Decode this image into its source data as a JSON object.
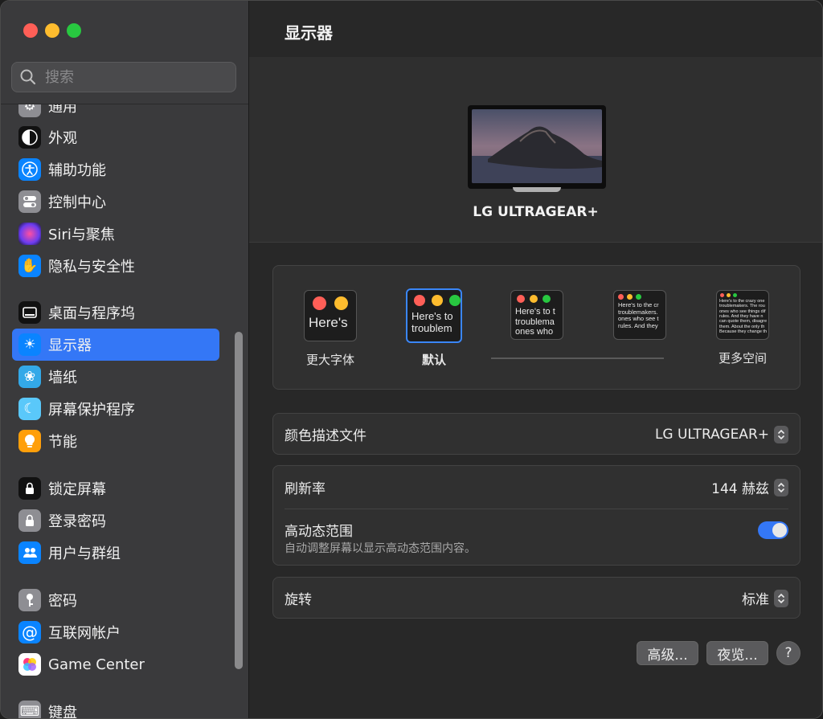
{
  "sidebar": {
    "search_placeholder": "搜索",
    "items": [
      {
        "label": "通用",
        "icon": "gear-icon",
        "color": "#8e8e93"
      },
      {
        "label": "外观",
        "icon": "appearance-icon",
        "color": "#1c1c1e"
      },
      {
        "label": "辅助功能",
        "icon": "accessibility-icon",
        "color": "#0a84ff"
      },
      {
        "label": "控制中心",
        "icon": "control-center-icon",
        "color": "#8e8e93"
      },
      {
        "label": "Siri与聚焦",
        "icon": "siri-icon",
        "color": "#b14ee0"
      },
      {
        "label": "隐私与安全性",
        "icon": "hand-icon",
        "color": "#0a84ff"
      },
      {
        "label": "桌面与程序坞",
        "icon": "dock-icon",
        "color": "#1c1c1e"
      },
      {
        "label": "显示器",
        "icon": "sun-icon",
        "color": "#0a84ff"
      },
      {
        "label": "墙纸",
        "icon": "flower-icon",
        "color": "#33a9e8"
      },
      {
        "label": "屏幕保护程序",
        "icon": "screensaver-icon",
        "color": "#5ac8fa"
      },
      {
        "label": "节能",
        "icon": "lightbulb-icon",
        "color": "#ff9f0a"
      },
      {
        "label": "锁定屏幕",
        "icon": "lock-screen-icon",
        "color": "#1c1c1e"
      },
      {
        "label": "登录密码",
        "icon": "lock-icon",
        "color": "#8e8e93"
      },
      {
        "label": "用户与群组",
        "icon": "users-icon",
        "color": "#0a84ff"
      },
      {
        "label": "密码",
        "icon": "key-icon",
        "color": "#8e8e93"
      },
      {
        "label": "互联网帐户",
        "icon": "at-icon",
        "color": "#0a84ff"
      },
      {
        "label": "Game Center",
        "icon": "game-center-icon",
        "color": "#ffffff"
      },
      {
        "label": "键盘",
        "icon": "keyboard-icon",
        "color": "#8e8e93"
      }
    ]
  },
  "main": {
    "title": "显示器",
    "monitor_name": "LG ULTRAGEAR+",
    "resolution_options": [
      {
        "label": "更大字体",
        "sample": "Here's"
      },
      {
        "label": "默认",
        "sample": "Here's to troublem"
      },
      {
        "label": "",
        "sample": "Here's to t troublema ones who"
      },
      {
        "label": "",
        "sample": "Here's to the cr troublemakers. ones who see t rules. And they"
      },
      {
        "label": "更多空间",
        "sample": "Here's to the crazy one troublemakers. The rou ones who see things dif rules. And they have n can quote them, disagre them. About the only th Because they change th"
      }
    ],
    "color_profile_label": "颜色描述文件",
    "color_profile_value": "LG ULTRAGEAR+",
    "refresh_rate_label": "刷新率",
    "refresh_rate_value": "144 赫兹",
    "hdr_label": "高动态范围",
    "hdr_desc": "自动调整屏幕以显示高动态范围内容。",
    "hdr_on": true,
    "rotation_label": "旋转",
    "rotation_value": "标准",
    "advanced_button": "高级...",
    "night_shift_button": "夜览...",
    "help_button": "?"
  }
}
